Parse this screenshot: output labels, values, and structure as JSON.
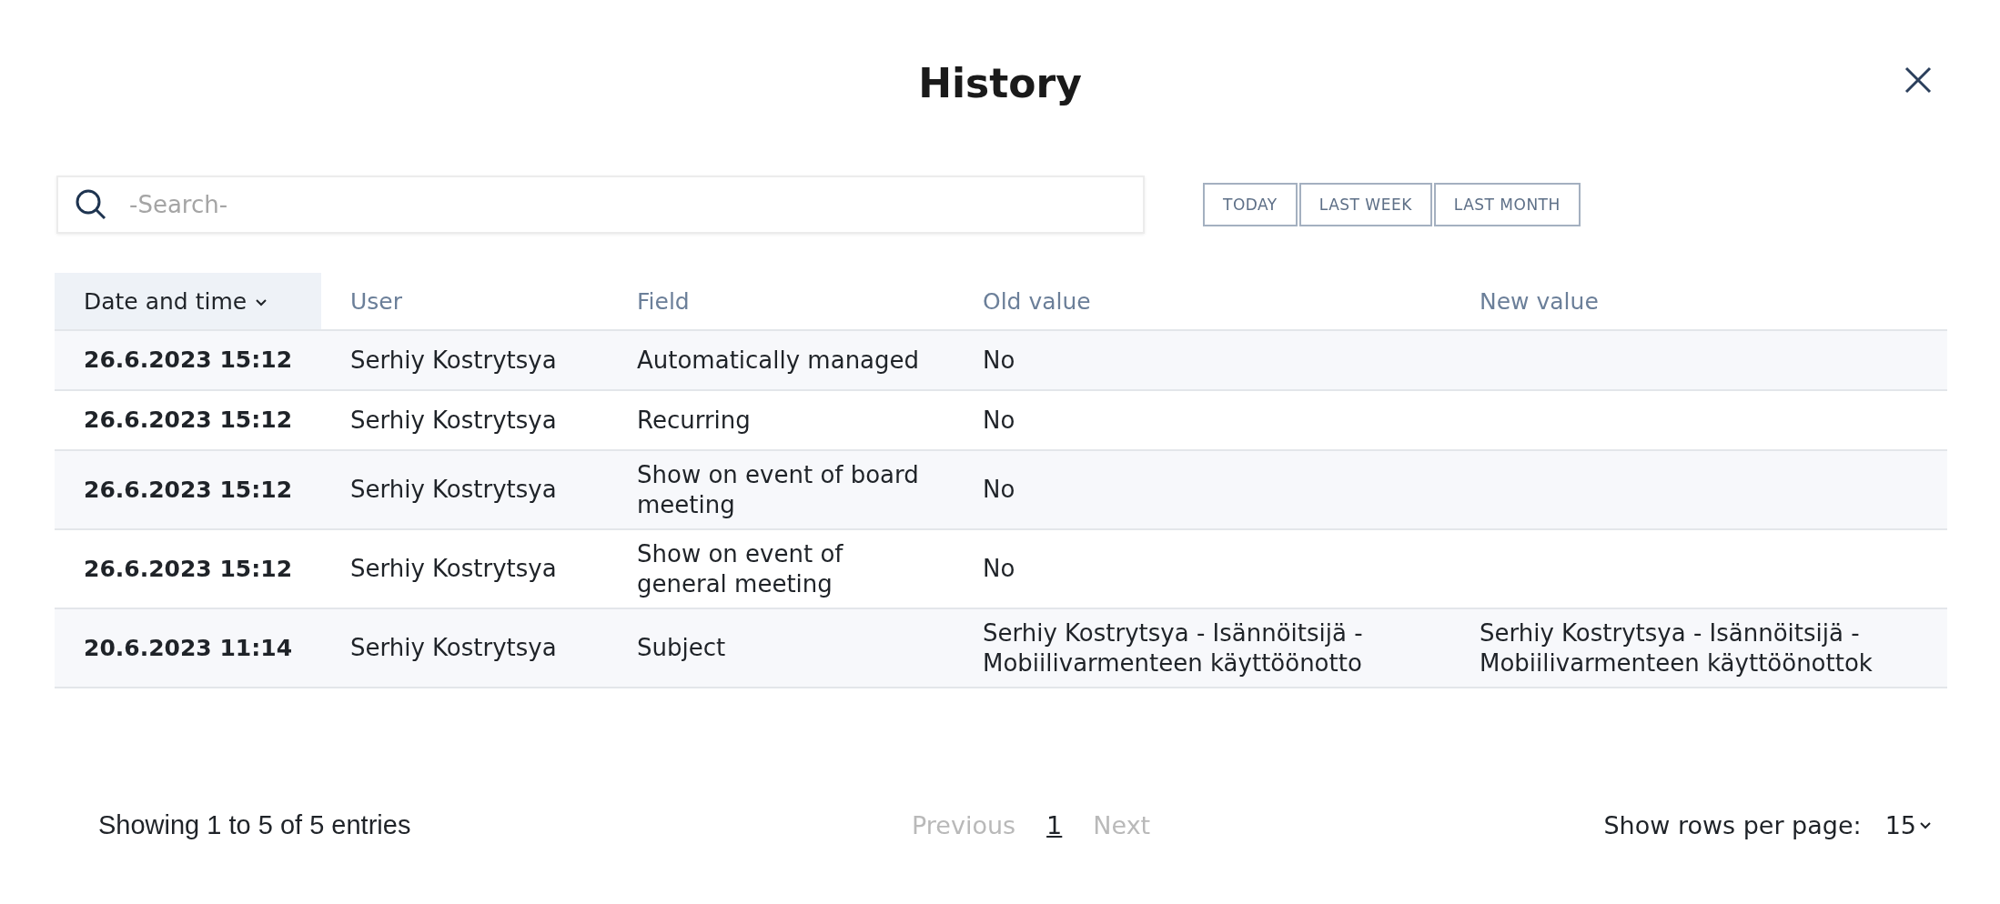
{
  "dialog": {
    "title": "History"
  },
  "search": {
    "placeholder": "-Search-"
  },
  "filters": [
    {
      "label": "TODAY",
      "selected": false
    },
    {
      "label": "LAST WEEK",
      "selected": false
    },
    {
      "label": "LAST MONTH",
      "selected": false
    }
  ],
  "table": {
    "columns": [
      {
        "label": "Date and time",
        "selected": true
      },
      {
        "label": "User",
        "selected": false
      },
      {
        "label": "Field",
        "selected": false
      },
      {
        "label": "Old value",
        "selected": false
      },
      {
        "label": "New value",
        "selected": false
      }
    ],
    "rows": [
      [
        "26.6.2023 15:12",
        "Serhiy Kostrytsya",
        "Automatically managed",
        "No",
        ""
      ],
      [
        "26.6.2023 15:12",
        "Serhiy Kostrytsya",
        "Recurring",
        "No",
        ""
      ],
      [
        "26.6.2023 15:12",
        "Serhiy Kostrytsya",
        "Show on event of board meeting",
        "No",
        ""
      ],
      [
        "26.6.2023 15:12",
        "Serhiy Kostrytsya",
        "Show on event of general meeting",
        "No",
        ""
      ],
      [
        "20.6.2023 11:14",
        "Serhiy Kostrytsya",
        "Subject",
        "Serhiy Kostrytsya - Isännöitsijä - Mobiilivarmenteen käyttöönotto",
        "Serhiy Kostrytsya - Isännöitsijä - Mobiilivarmenteen käyttöönottok"
      ]
    ]
  },
  "footer": {
    "info": "Showing 1 to 5 of 5 entries",
    "pages": [
      {
        "label": "Previous",
        "disabled": true,
        "selected": false
      },
      {
        "label": "1",
        "disabled": false,
        "selected": true
      },
      {
        "label": "Next",
        "disabled": true,
        "selected": false
      }
    ],
    "rows_label": "Show rows per page:",
    "rows_value": "15"
  }
}
